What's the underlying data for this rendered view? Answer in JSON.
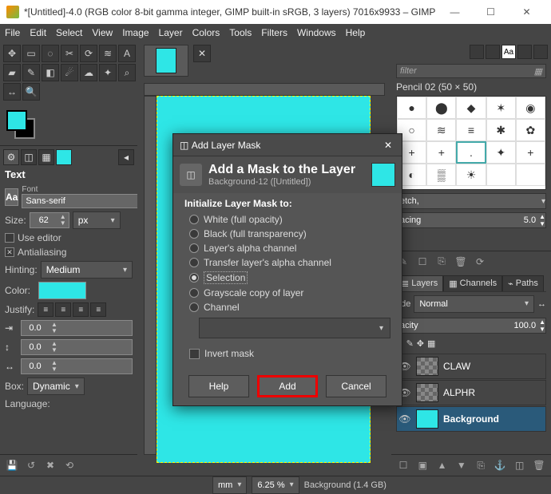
{
  "window": {
    "title": "*[Untitled]-4.0 (RGB color 8-bit gamma integer, GIMP built-in sRGB, 3 layers) 7016x9933 – GIMP",
    "min": "—",
    "max": "☐",
    "close": "✕"
  },
  "menu": [
    "File",
    "Edit",
    "Select",
    "View",
    "Image",
    "Layer",
    "Colors",
    "Tools",
    "Filters",
    "Windows",
    "Help"
  ],
  "accent": "#2EE6E6",
  "text_panel": {
    "title": "Text",
    "font_label": "Font",
    "font_value": "Sans-serif",
    "font_badge": "Aa",
    "size_label": "Size:",
    "size_value": "62",
    "size_unit": "px",
    "use_editor": "Use editor",
    "antialias": "Antialiasing",
    "antialias_on": "✕",
    "hinting_label": "Hinting:",
    "hinting_value": "Medium",
    "color_label": "Color:",
    "justify_label": "Justify:",
    "indent1": "0.0",
    "indent2": "0.0",
    "indent3": "0.0",
    "box_label": "Box:",
    "box_value": "Dynamic",
    "language_label": "Language:"
  },
  "right": {
    "filter_placeholder": "filter",
    "brush_label": "Pencil 02 (50 × 50)",
    "spacing_label": "acing",
    "spacing_value": "5.0",
    "stretch_label": "etch,",
    "mode_label": "ode",
    "mode_value": "Normal",
    "opacity_label": "acity",
    "opacity_value": "100.0",
    "lock_label": "k:",
    "tabs": {
      "layers": "Layers",
      "channels": "Channels",
      "paths": "Paths"
    },
    "layers": [
      {
        "name": "CLAW",
        "active": false,
        "cyan": false
      },
      {
        "name": "ALPHR",
        "active": false,
        "cyan": false
      },
      {
        "name": "Background",
        "active": true,
        "cyan": true
      }
    ]
  },
  "status": {
    "unit": "mm",
    "zoom": "6.25 %",
    "layer_info": "Background (1.4 GB)"
  },
  "dialog": {
    "title": "Add Layer Mask",
    "heading": "Add a Mask to the Layer",
    "sub": "Background-12 ([Untitled])",
    "group": "Initialize Layer Mask to:",
    "options": [
      "White (full opacity)",
      "Black (full transparency)",
      "Layer's alpha channel",
      "Transfer layer's alpha channel",
      "Selection",
      "Grayscale copy of layer",
      "Channel"
    ],
    "selected_index": 4,
    "invert": "Invert mask",
    "help": "Help",
    "add": "Add",
    "cancel": "Cancel"
  }
}
